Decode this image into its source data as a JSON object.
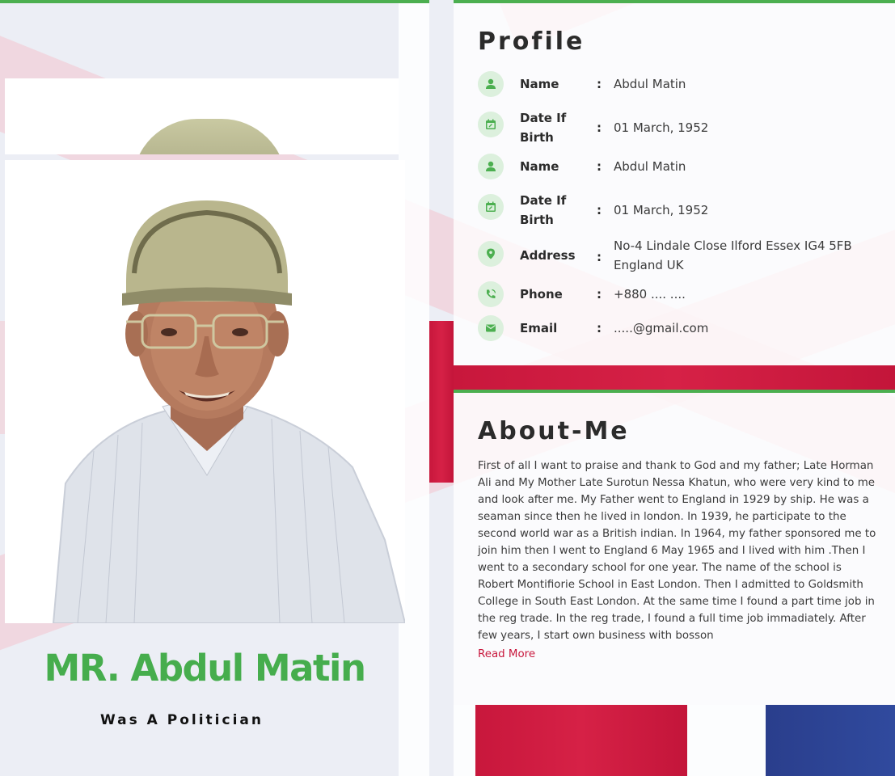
{
  "hero": {
    "name": "MR. Abdul Matin",
    "subtitle": "Was A Politician"
  },
  "profile": {
    "title": "Profile",
    "rows": [
      {
        "icon": "person-icon",
        "label": "Name",
        "value": "Abdul Matin"
      },
      {
        "icon": "calendar-icon",
        "label": "Date If Birth",
        "value": "01 March, 1952"
      },
      {
        "icon": "person-icon",
        "label": "Name",
        "value": "Abdul Matin"
      },
      {
        "icon": "calendar-icon",
        "label": "Date If Birth",
        "value": "01 March, 1952"
      },
      {
        "icon": "location-pin-icon",
        "label": "Address",
        "value": "No-4 Lindale Close Ilford Essex IG4 5FB England UK"
      },
      {
        "icon": "phone-icon",
        "label": "Phone",
        "value": "+880 .... ...."
      },
      {
        "icon": "envelope-icon",
        "label": "Email",
        "value": ".....@gmail.com"
      }
    ],
    "separator": ":"
  },
  "about": {
    "title": "About-Me",
    "text": "First of all I want to praise and thank to God and my father; Late Horman Ali and My Mother Late Surotun Nessa Khatun, who were very kind to me and look after me. My Father went to England in 1929 by ship. He was a seaman since then he lived in london. In 1939, he participate to the second world war as a British indian. In 1964, my father sponsored me to join him then I went to England 6 May 1965 and I lived with him .Then I went to a secondary school for one year. The name of the school is Robert Montifiorie School in East London. Then I admitted to Goldsmith College in South East London. At the same time I found a part time job in the reg trade. In the reg trade, I found a full time job immadiately. After few years, I start own business with bosson",
    "read_more": "Read More"
  },
  "colors": {
    "accent_green": "#46ad4d",
    "flag_red": "#c8173c",
    "flag_blue": "#2a3e8c",
    "icon_bg": "#dcf0dd"
  }
}
